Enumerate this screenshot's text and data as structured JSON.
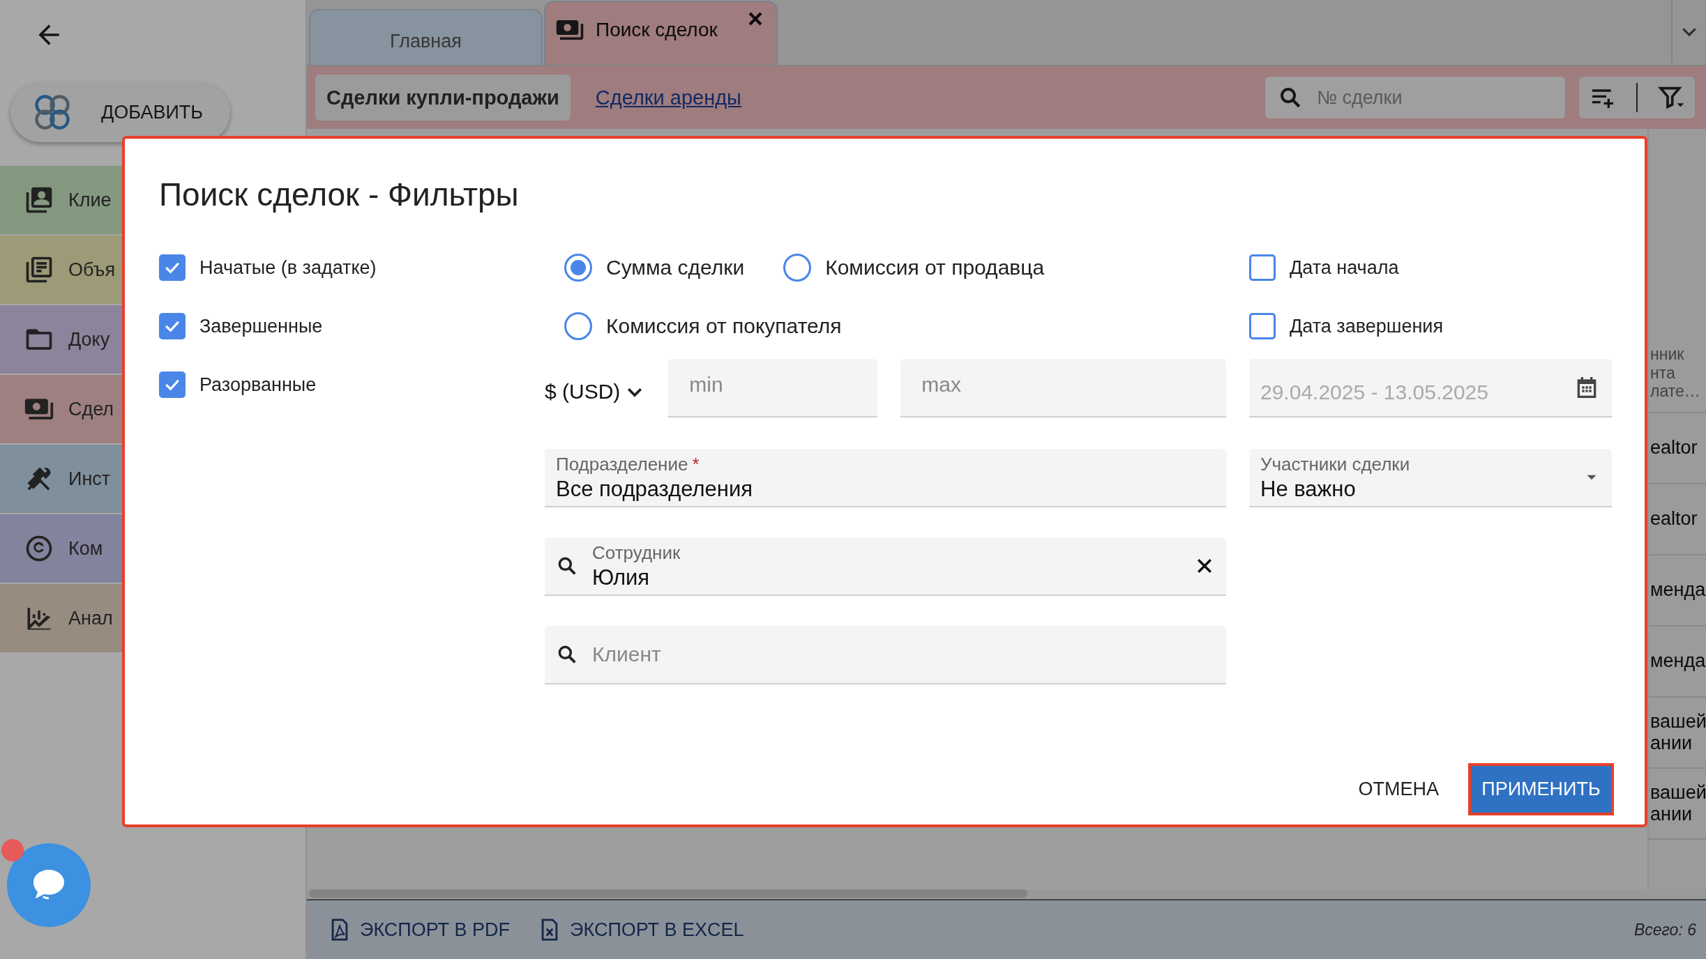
{
  "sidebar": {
    "add_button": "ДОБАВИТЬ",
    "items": [
      {
        "label": "Клие",
        "kind": "contacts",
        "color": "#84987f"
      },
      {
        "label": "Объя",
        "kind": "listing",
        "color": "#9d9b77"
      },
      {
        "label": "Доку",
        "kind": "folder",
        "color": "#8d839c"
      },
      {
        "label": "Сдел",
        "kind": "money",
        "color": "#9e8080"
      },
      {
        "label": "Инст",
        "kind": "tools",
        "color": "#808f9c"
      },
      {
        "label": "Ком",
        "kind": "copyright",
        "color": "#84839d"
      },
      {
        "label": "Анал",
        "kind": "chart",
        "color": "#988b80"
      }
    ]
  },
  "tabs": [
    {
      "label": "Главная",
      "selected": false
    },
    {
      "label": "Поиск сделок",
      "selected": true
    }
  ],
  "subtabs": [
    {
      "label": "Сделки купли-продажи",
      "selected": true
    },
    {
      "label": "Сделки аренды",
      "selected": false
    }
  ],
  "search": {
    "placeholder": "№ сделки"
  },
  "table": {
    "cells": [
      {
        "lines": [
          "нник",
          "нта",
          "лате…"
        ]
      },
      {
        "lines": [
          "ealtor"
        ]
      },
      {
        "lines": [
          "ealtor"
        ]
      },
      {
        "lines": [
          "менда"
        ]
      },
      {
        "lines": [
          "менда"
        ]
      },
      {
        "lines": [
          "вашей",
          "ании"
        ]
      },
      {
        "lines": [
          "вашей",
          "ании"
        ]
      }
    ]
  },
  "footer": {
    "exports": [
      {
        "label": "ЭКСПОРТ В PDF",
        "kind": "pdf"
      },
      {
        "label": "ЭКСПОРТ В EXCEL",
        "kind": "excel"
      }
    ],
    "total": "Всего: 6"
  },
  "dialog": {
    "title": "Поиск сделок - Фильтры",
    "status_filters": [
      {
        "label": "Начатые (в задатке)",
        "checked": true
      },
      {
        "label": "Завершенные",
        "checked": true
      },
      {
        "label": "Разорванные",
        "checked": true
      }
    ],
    "amount_types": [
      {
        "label": "Сумма сделки",
        "selected": true
      },
      {
        "label": "Комиссия от продавца",
        "selected": false
      },
      {
        "label": "Комиссия от покупателя",
        "selected": false
      }
    ],
    "date_filters": [
      {
        "label": "Дата начала",
        "checked": false
      },
      {
        "label": "Дата завершения",
        "checked": false
      }
    ],
    "currency": "$ (USD)",
    "min": {
      "placeholder": "min"
    },
    "max": {
      "placeholder": "max"
    },
    "date_range": {
      "value": "29.04.2025 - 13.05.2025",
      "disabled": true
    },
    "division": {
      "label": "Подразделение",
      "required_mark": "*",
      "value": "Все подразделения"
    },
    "participants": {
      "label": "Участники сделки",
      "value": "Не важно"
    },
    "employee": {
      "label": "Сотрудник",
      "value": "Юлия"
    },
    "client": {
      "placeholder": "Клиент"
    },
    "cancel": "ОТМЕНА",
    "apply": "ПРИМЕНИТЬ"
  }
}
